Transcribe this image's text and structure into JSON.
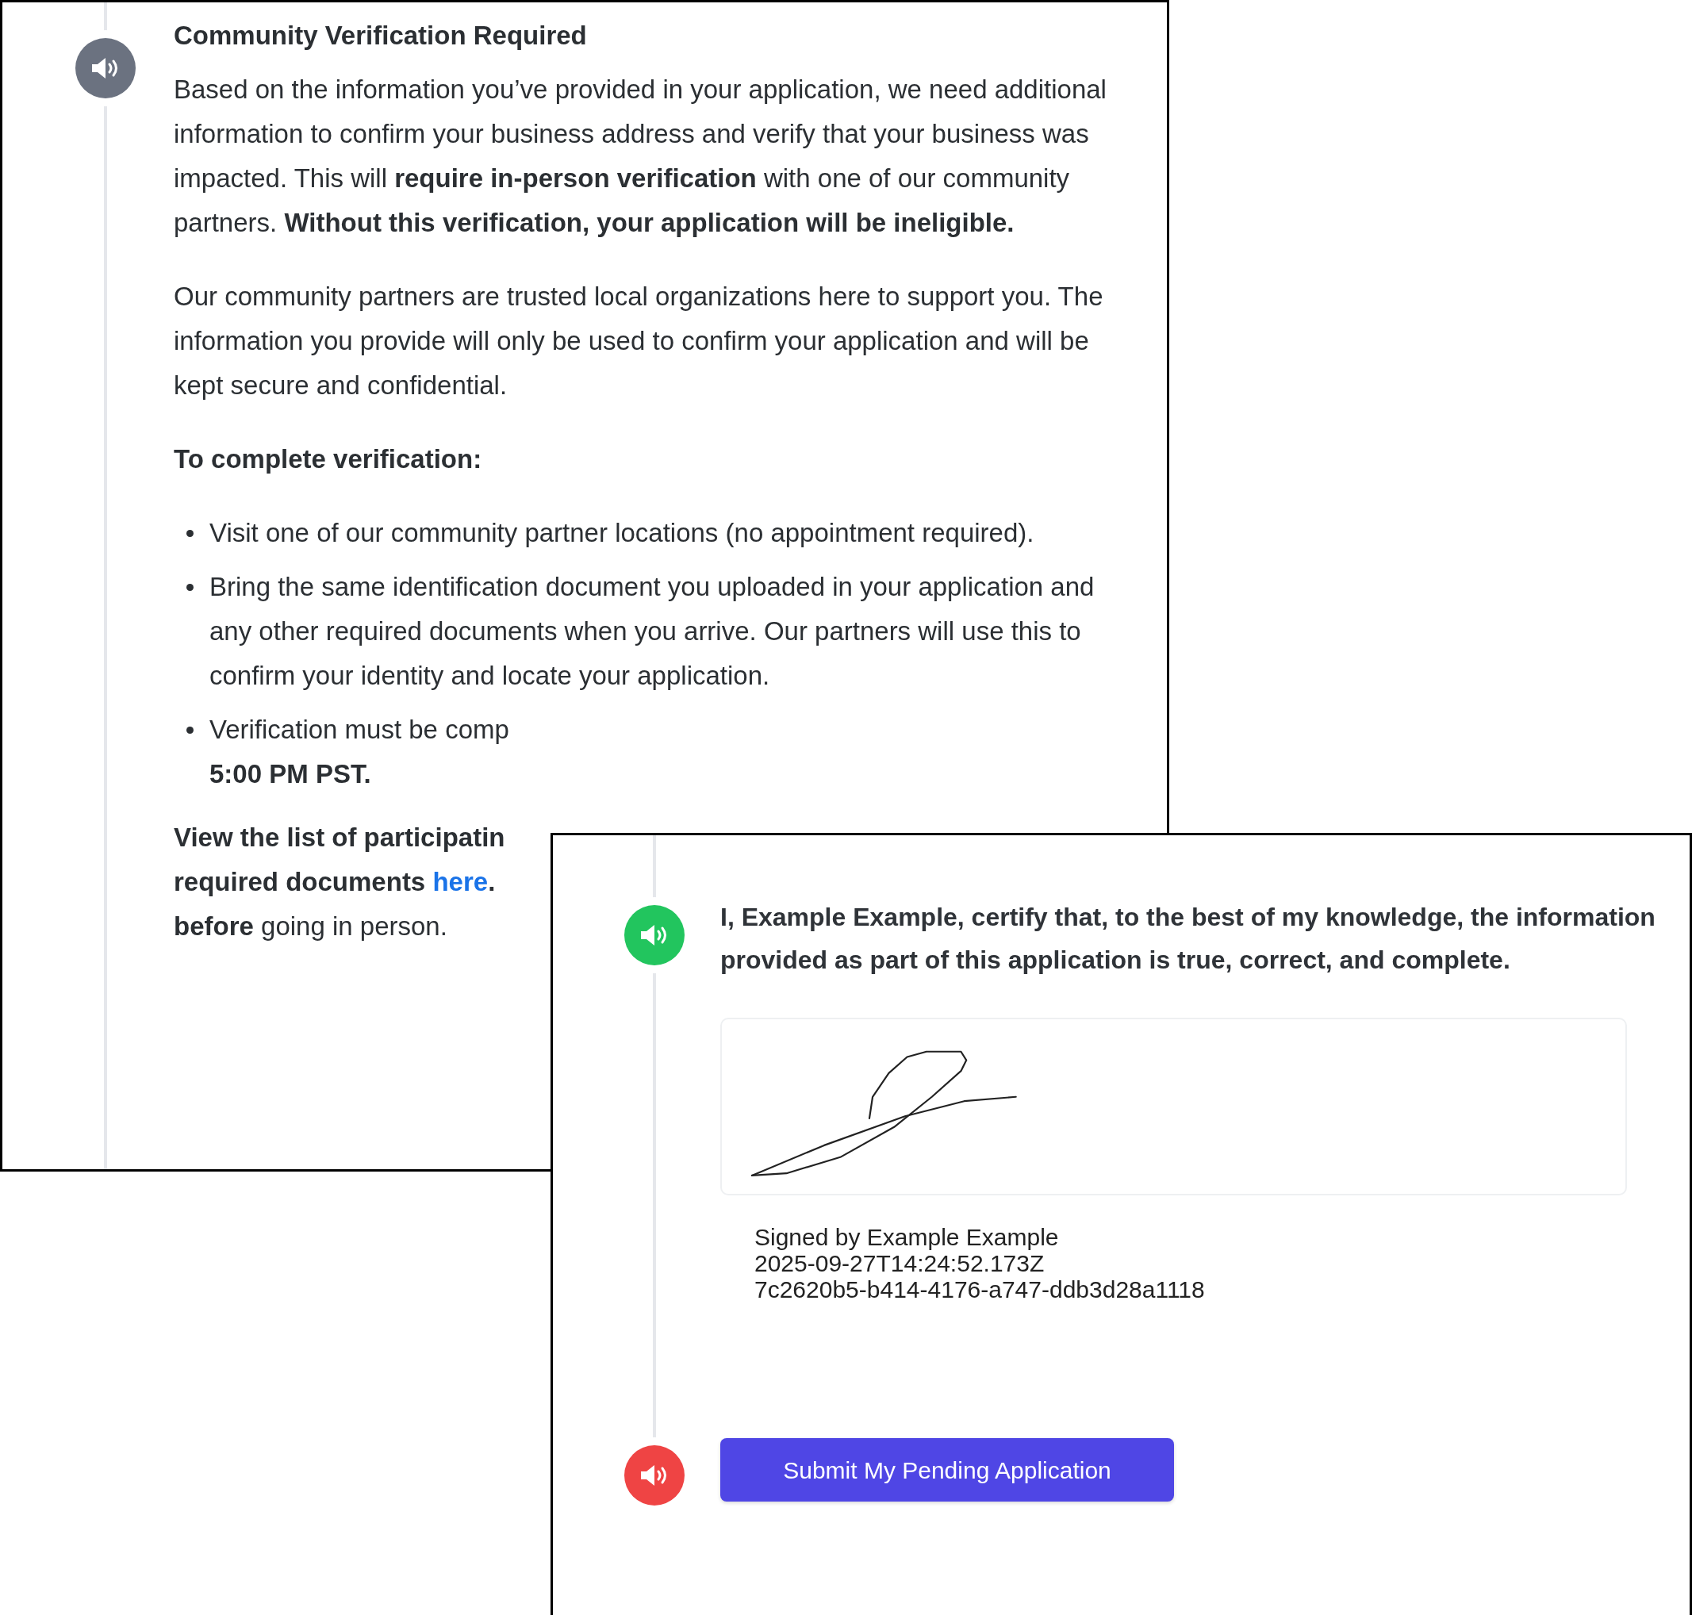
{
  "notice_panel": {
    "audio_button": {
      "color": "#6b7280"
    },
    "title": "Community Verification Required",
    "paragraphs": [
      "Based on the information you’ve provided in your application, we need additional information to confirm your business address and verify that your business was impacted. This will **require in-person verification** with one of our community partners. **Without this verification, your application will be ineligible.**",
      "Our community partners are trusted local organizations here to support you. The information you provide will only be used to confirm your application and will be kept secure and confidential."
    ],
    "subheading": "To complete verification:",
    "bullets": [
      {
        "lines": [
          "Visit one of our community partner locations (no appointment required)."
        ]
      },
      {
        "lines": [
          "Bring the same identification document you uploaded in your application and any other required documents when you arrive. Our partners will use this to confirm your identity and locate your application."
        ]
      },
      {
        "lines": [
          "Verification must be comp",
          "**5:00 PM PST.**"
        ]
      }
    ],
    "closing": {
      "lines": [
        {
          "text": "**View the list of participatin**"
        },
        {
          "text": "**required documents**",
          "link": "here",
          "after": "**.**"
        },
        {
          "text": "**before** going in person."
        }
      ]
    }
  },
  "certification_panel": {
    "statement": {
      "audio_button": {
        "color": "#22c55e"
      },
      "text": "I, Example Example, certify that, to the best of my knowledge, the information provided as part of this application is true, correct, and complete."
    },
    "signature": {
      "signed_by": "Signed by Example Example",
      "timestamp": "2025-09-27T14:24:52.173Z",
      "id": "7c2620b5-b414-4176-a747-ddb3d28a1118"
    },
    "submit": {
      "audio_button": {
        "color": "#ef4444"
      },
      "label": "Submit My Pending Application"
    }
  }
}
